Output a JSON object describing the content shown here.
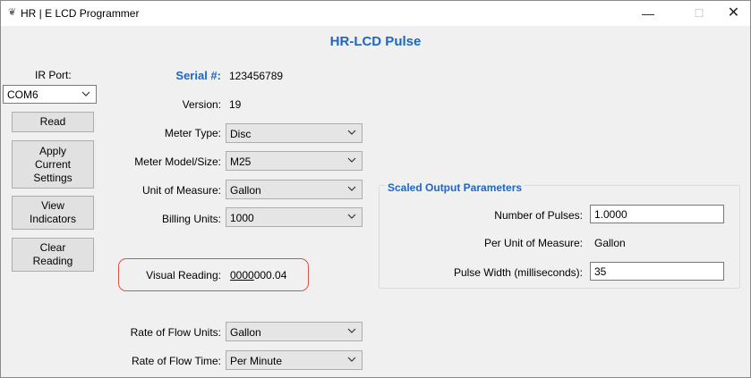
{
  "window": {
    "title": "HR | E LCD Programmer",
    "min": "—",
    "max": "☐",
    "close": "✕"
  },
  "header": "HR-LCD Pulse",
  "sidebar": {
    "ir_port_label": "IR Port:",
    "ir_port_value": "COM6",
    "buttons": {
      "read": "Read",
      "apply": [
        "Apply",
        "Current",
        "Settings"
      ],
      "view": [
        "View",
        "Indicators"
      ],
      "clear": [
        "Clear",
        "Reading"
      ]
    }
  },
  "main": {
    "serial_label": "Serial #:",
    "serial_value": "123456789",
    "version_label": "Version:",
    "version_value": "19",
    "meter_type_label": "Meter Type:",
    "meter_type_value": "Disc",
    "meter_model_label": "Meter Model/Size:",
    "meter_model_value": "M25",
    "unit_label": "Unit of Measure:",
    "unit_value": "Gallon",
    "billing_label": "Billing Units:",
    "billing_value": "1000",
    "visual_label": "Visual Reading:",
    "visual_value_underlined": "0000",
    "visual_value_rest": "000.04",
    "flow_units_label": "Rate of Flow Units:",
    "flow_units_value": "Gallon",
    "flow_time_label": "Rate of Flow Time:",
    "flow_time_value": "Per Minute"
  },
  "scaled": {
    "title": "Scaled Output Parameters",
    "pulses_label": "Number of Pulses:",
    "pulses_value": "1.0000",
    "per_unit_label": "Per Unit of Measure:",
    "per_unit_value": "Gallon",
    "pulse_width_label": "Pulse Width (milliseconds):",
    "pulse_width_value": "35"
  },
  "colors": {
    "accent": "#1f66c3",
    "highlight": "#d9534f"
  }
}
